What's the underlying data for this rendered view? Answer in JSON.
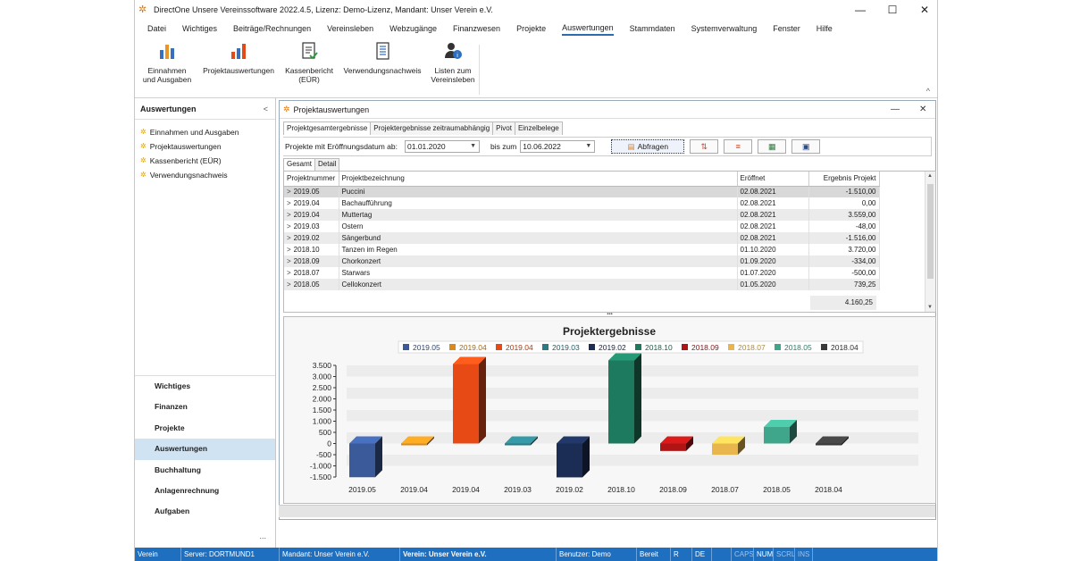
{
  "window": {
    "title": "DirectOne Unsere Vereinssoftware 2022.4.5, Lizenz: Demo-Lizenz, Mandant: Unser Verein e.V.",
    "minimize": "—",
    "maximize": "☐",
    "close": "✕"
  },
  "menu": [
    "Datei",
    "Wichtiges",
    "Beiträge/Rechnungen",
    "Vereinsleben",
    "Webzugänge",
    "Finanzwesen",
    "Projekte",
    "Auswertungen",
    "Stammdaten",
    "Systemverwaltung",
    "Fenster",
    "Hilfe"
  ],
  "ribbon": {
    "buttons": [
      {
        "line1": "Einnahmen",
        "line2": "und Ausgaben",
        "icon": "bar-chart-icon"
      },
      {
        "line1": "Projektauswertungen",
        "line2": "",
        "icon": "bar-chart-icon"
      },
      {
        "line1": "Kassenbericht",
        "line2": "(EÜR)",
        "icon": "report-icon"
      },
      {
        "line1": "Verwendungsnachweis",
        "line2": "",
        "icon": "document-list-icon"
      },
      {
        "line1": "Listen zum",
        "line2": "Vereinsleben",
        "icon": "user-info-icon"
      }
    ],
    "collapse": "^"
  },
  "sidebar": {
    "title": "Auswertungen",
    "chevron": "<",
    "items": [
      "Einnahmen und Ausgaben",
      "Projektauswertungen",
      "Kassenbericht (EÜR)",
      "Verwendungsnachweis"
    ],
    "nav": [
      "Wichtiges",
      "Finanzen",
      "Projekte",
      "Auswertungen",
      "Buchhaltung",
      "Anlagenrechnung",
      "Aufgaben"
    ],
    "active_nav": "Auswertungen",
    "more": "..."
  },
  "inner_window": {
    "title": "Projektauswertungen",
    "minimize": "—",
    "close": "✕"
  },
  "tabs": [
    "Projektgesamtergebnisse",
    "Projektergebnisse zeitraumabhängig",
    "Pivot",
    "Einzelbelege"
  ],
  "filter": {
    "label_from": "Projekte mit Eröffnungsdatum ab:",
    "from": "01.01.2020",
    "label_to": "bis zum",
    "to": "10.06.2022",
    "query_button": "Abfragen"
  },
  "subtabs": [
    "Gesamt",
    "Detail"
  ],
  "table": {
    "columns": [
      "Projektnummer",
      "Projektbezeichnung",
      "Eröffnet",
      "Ergebnis Projekt"
    ],
    "rows": [
      [
        "2019.05",
        "Puccini",
        "02.08.2021",
        "-1.510,00"
      ],
      [
        "2019.04",
        "Bachaufführung",
        "02.08.2021",
        "0,00"
      ],
      [
        "2019.04",
        "Muttertag",
        "02.08.2021",
        "3.559,00"
      ],
      [
        "2019.03",
        "Ostern",
        "02.08.2021",
        "-48,00"
      ],
      [
        "2019.02",
        "Sängerbund",
        "02.08.2021",
        "-1.516,00"
      ],
      [
        "2018.10",
        "Tanzen im Regen",
        "01.10.2020",
        "3.720,00"
      ],
      [
        "2018.09",
        "Chorkonzert",
        "01.09.2020",
        "-334,00"
      ],
      [
        "2018.07",
        "Starwars",
        "01.07.2020",
        "-500,00"
      ],
      [
        "2018.05",
        "Cellokonzert",
        "01.05.2020",
        "739,25"
      ]
    ],
    "total": "4.160,25"
  },
  "chart_data": {
    "type": "bar",
    "title": "Projektergebnisse",
    "categories": [
      "2019.05",
      "2019.04",
      "2019.04",
      "2019.03",
      "2019.02",
      "2018.10",
      "2018.09",
      "2018.07",
      "2018.05",
      "2018.04"
    ],
    "values": [
      -1510,
      0,
      3559,
      -48,
      -1516,
      3720,
      -334,
      -500,
      739.25,
      0
    ],
    "colors": [
      "#3a5a9a",
      "#d98a1c",
      "#e84a16",
      "#2b7b86",
      "#1b2c55",
      "#1e7a5e",
      "#b01515",
      "#e8b64c",
      "#3fa58b",
      "#3a3a3a"
    ],
    "yticks": [
      "3.500",
      "3.000",
      "2.500",
      "2.000",
      "1.500",
      "1.000",
      "500",
      "0",
      "-500",
      "-1.000",
      "-1.500"
    ],
    "ylim": [
      -1500,
      3500
    ],
    "legend_position": "top",
    "grid": true
  },
  "status": {
    "segments": [
      "Verein",
      "Server: DORTMUND1",
      "Mandant: Unser Verein e.V.",
      "Verein: Unser Verein e.V.",
      "Benutzer: Demo",
      "Bereit",
      "R",
      "DE",
      "",
      "CAPS",
      "NUM",
      "SCRL",
      "INS"
    ]
  }
}
